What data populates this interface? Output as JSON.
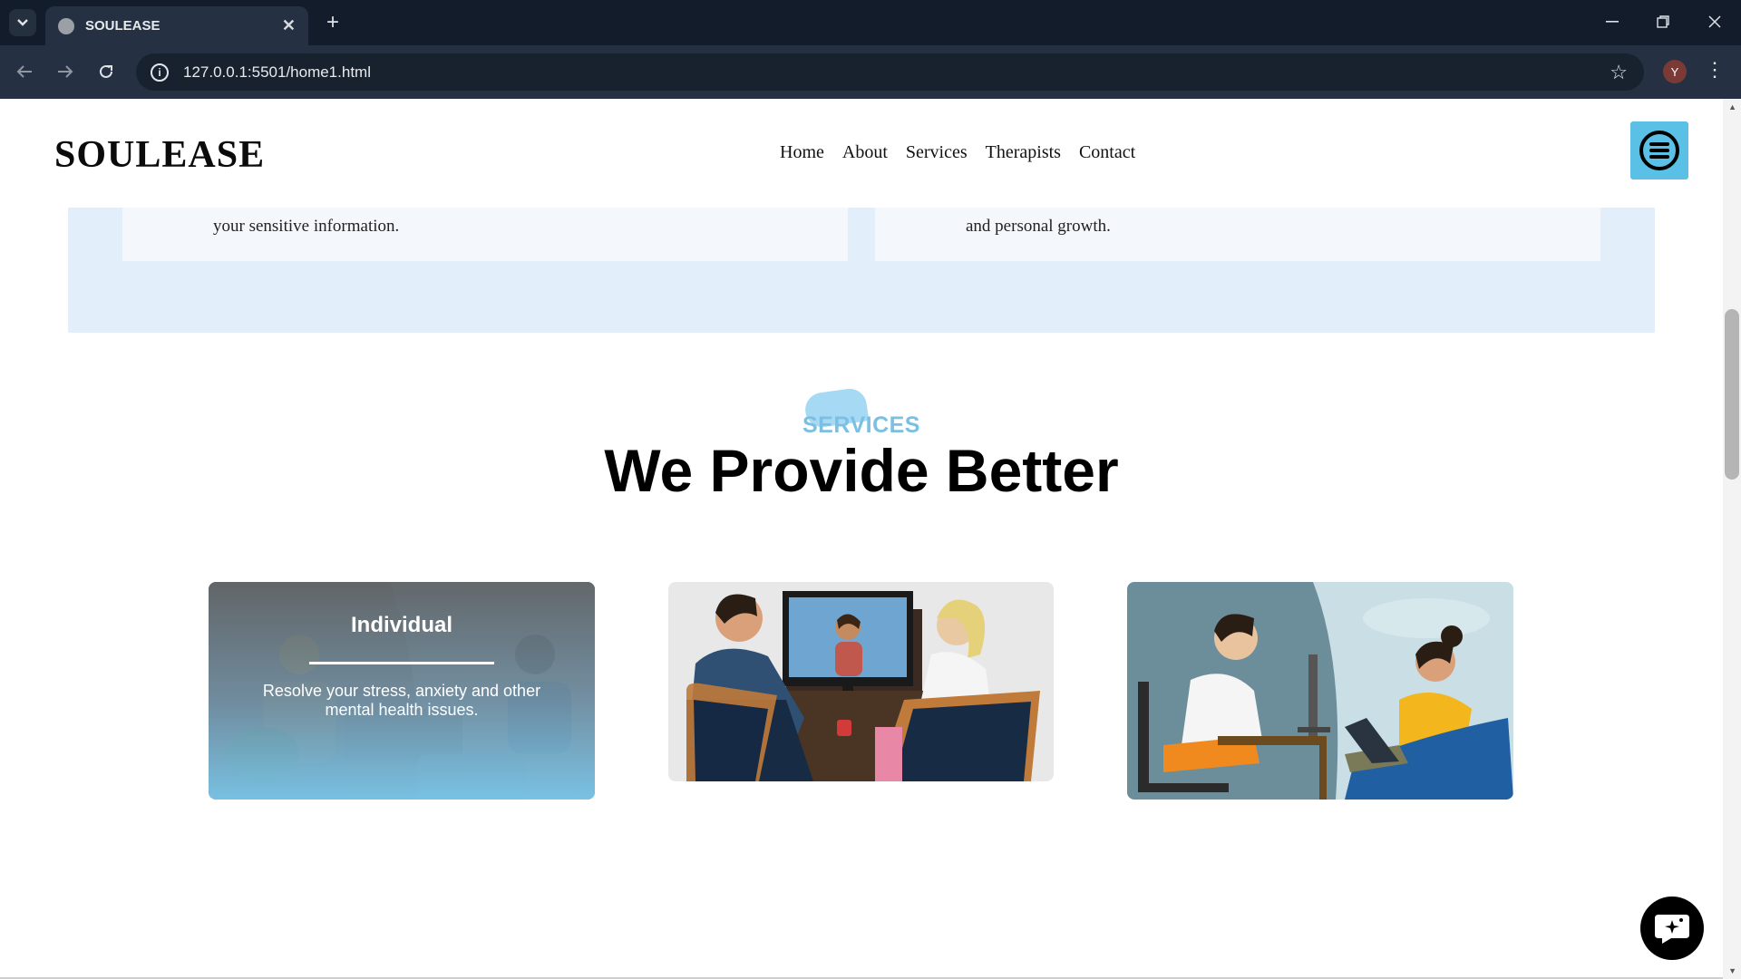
{
  "browser": {
    "tab_title": "SOULEASE",
    "url": "127.0.0.1:5501/home1.html",
    "profile_initial": "Y"
  },
  "header": {
    "logo": "SOULEASE",
    "nav": [
      "Home",
      "About",
      "Services",
      "Therapists",
      "Contact"
    ]
  },
  "features": {
    "left_text": "your sensitive information.",
    "right_text": "and personal growth."
  },
  "services": {
    "label": "SERVICES",
    "title": "We Provide Better",
    "cards": [
      {
        "title": "Individual",
        "description": "Resolve your stress, anxiety and other mental health issues."
      }
    ]
  },
  "colors": {
    "accent": "#5bc0e5",
    "band": "#e3eefb",
    "services_label": "#7bc0e3"
  },
  "icons": [
    "tab-list-icon",
    "globe-icon",
    "close-icon",
    "plus-icon",
    "minimize-icon",
    "restore-icon",
    "window-close-icon",
    "back-arrow-icon",
    "forward-arrow-icon",
    "reload-icon",
    "info-icon",
    "star-icon",
    "more-vert-icon",
    "menu-list-icon",
    "chat-icon"
  ]
}
